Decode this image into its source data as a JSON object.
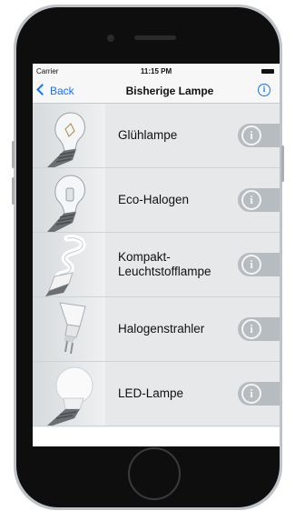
{
  "status_bar": {
    "carrier": "Carrier",
    "time": "11:15 PM"
  },
  "nav": {
    "back_label": "Back",
    "title": "Bisherige Lampe",
    "info_glyph": "i"
  },
  "items": [
    {
      "label": "Glühlampe",
      "icon": "incandescent-bulb-icon",
      "info_glyph": "i"
    },
    {
      "label": "Eco-Halogen",
      "icon": "eco-halogen-bulb-icon",
      "info_glyph": "i"
    },
    {
      "label": "Kompakt-\nLeuchtstofflampe",
      "icon": "compact-fluorescent-bulb-icon",
      "info_glyph": "i"
    },
    {
      "label": "Halogenstrahler",
      "icon": "halogen-spot-icon",
      "info_glyph": "i"
    },
    {
      "label": "LED-Lampe",
      "icon": "led-bulb-icon",
      "info_glyph": "i"
    }
  ],
  "colors": {
    "accent": "#1a73e8",
    "row_bg": "#e6e8ea",
    "info_btn": "#b7bcc1"
  }
}
